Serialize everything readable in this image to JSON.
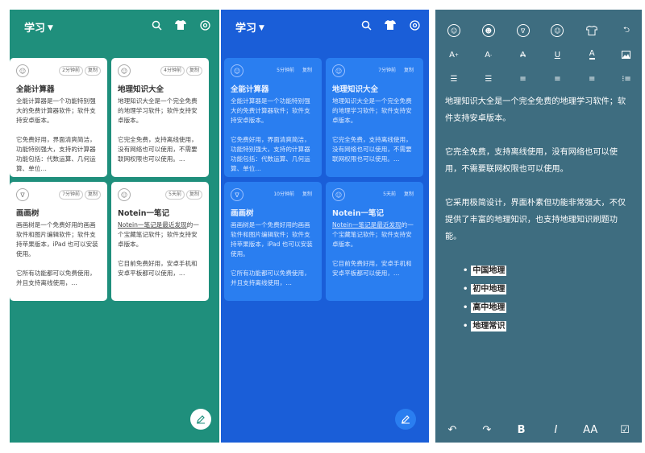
{
  "panels": [
    {
      "title": "学习",
      "cards": [
        {
          "time": "2分钟前",
          "action": "复制",
          "title": "全能计算器",
          "p1": "全能计算器是一个功能特别强大的免费计算器软件；软件支持安卓版本。",
          "p2": "它免费好用，界面清爽简洁，功能特别强大，支持的计算器功能包括：代数运算、几何运算、单位…"
        },
        {
          "time": "4分钟前",
          "action": "复制",
          "title": "地理知识大全",
          "p1": "地理知识大全是一个完全免费的地理学习软件；软件支持安卓版本。",
          "p2": "它完全免费，支持离线使用，没有网络也可以使用，不需要联网权限也可以使用。…"
        },
        {
          "time": "7分钟前",
          "action": "复制",
          "title": "画画树",
          "p1": "画画树是一个免费好用的画画软件和图片编辑软件；软件支持苹果版本，iPad 也可以安装使用。",
          "p2": "它所有功能都可以免费使用，并且支持离线使用，…"
        },
        {
          "time": "5天前",
          "action": "复制",
          "title": "Notein一笔记",
          "p1u": "Notein一笔记是最近发现",
          "p1": "的一个宝藏笔记软件；软件支持安卓版本。",
          "p2": "它目前免费好用，安卓手机和安卓平板都可以使用，…"
        }
      ]
    },
    {
      "title": "学习",
      "cards": [
        {
          "time": "5分钟前",
          "action": "复制",
          "title": "全能计算器",
          "p1": "全能计算器是一个功能特别强大的免费计算器软件；软件支持安卓版本。",
          "p2": "它免费好用，界面清爽简洁，功能特别强大，支持的计算器功能包括：代数运算、几何运算、单位…"
        },
        {
          "time": "7分钟前",
          "action": "复制",
          "title": "地理知识大全",
          "p1": "地理知识大全是一个完全免费的地理学习软件；软件支持安卓版本。",
          "p2": "它完全免费，支持离线使用，没有网络也可以使用，不需要联网权限也可以使用。…"
        },
        {
          "time": "10分钟前",
          "action": "复制",
          "title": "画画树",
          "p1": "画画树是一个免费好用的画画软件和图片编辑软件；软件支持苹果版本，iPad 也可以安装使用。",
          "p2": "它所有功能都可以免费使用，并且支持离线使用，…"
        },
        {
          "time": "5天前",
          "action": "复制",
          "title": "Notein一笔记",
          "p1u": "Notein一笔记是最近发现",
          "p1": "的一个宝藏笔记软件；软件支持安卓版本。",
          "p2": "它目前免费好用，安卓手机和安卓平板都可以使用，…"
        }
      ]
    }
  ],
  "editor": {
    "p1": "地理知识大全是一个完全免费的地理学习软件；软件支持安卓版本。",
    "p2": "它完全免费，支持离线使用，没有网络也可以使用，不需要联网权限也可以使用。",
    "p3": "它采用极简设计，界面朴素但功能非常强大，不仅提供了丰富的地理知识，也支持地理知识刷题功能。",
    "list": [
      "中国地理",
      "初中地理",
      "高中地理",
      "地理常识"
    ]
  },
  "colors": {
    "teal": "#1f8f7c",
    "blue": "#1a5ed8",
    "slate": "#3e6d80"
  }
}
